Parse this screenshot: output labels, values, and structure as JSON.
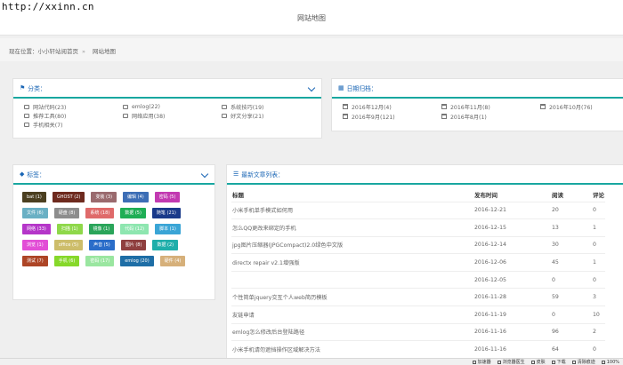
{
  "watermark": "http://xxinn.cn",
  "page_title": "网站地图",
  "breadcrumb": {
    "prefix": "现在位置：",
    "home": "小小轩站阅首页",
    "sep": "»",
    "current": "网站地图"
  },
  "categories": {
    "title": "分类：",
    "items": [
      "网站代码(23)",
      "emlog(22)",
      "系统技巧(19)",
      "推荐工具(80)",
      "网络应用(38)",
      "好文分享(21)",
      "手机相关(7)"
    ]
  },
  "archives": {
    "title": "日期归档：",
    "items": [
      "2016年12月(4)",
      "2016年11月(8)",
      "2016年10月(76)",
      "2016年9月(121)",
      "2016年8月(1)"
    ]
  },
  "tags": {
    "title": "标签：",
    "items": [
      {
        "label": "bat (1)",
        "color": "#4b3f20"
      },
      {
        "label": "GHOST (2)",
        "color": "#6e2a1e"
      },
      {
        "label": "变装 (3)",
        "color": "#9a6a6e"
      },
      {
        "label": "编辑 (4)",
        "color": "#3d6eb5"
      },
      {
        "label": "密码 (5)",
        "color": "#c23ab1"
      },
      {
        "label": "文件 (6)",
        "color": "#6ab0c4"
      },
      {
        "label": "硬盘 (8)",
        "color": "#8d8d8d"
      },
      {
        "label": "系统 (18)",
        "color": "#df6a6a"
      },
      {
        "label": "数据 (5)",
        "color": "#1fae55"
      },
      {
        "label": "随笔 (21)",
        "color": "#1a3a8a"
      },
      {
        "label": "网络 (33)",
        "color": "#b536c9"
      },
      {
        "label": "扫描 (1)",
        "color": "#8fd84a"
      },
      {
        "label": "镜像 (1)",
        "color": "#2aa55a"
      },
      {
        "label": "代码 (12)",
        "color": "#8ee6b0"
      },
      {
        "label": "脚本 (1)",
        "color": "#3aa5d6"
      },
      {
        "label": "浏览 (1)",
        "color": "#e24ed6"
      },
      {
        "label": "office (5)",
        "color": "#cdbd6a"
      },
      {
        "label": "声音 (5)",
        "color": "#2a6dc9"
      },
      {
        "label": "图片 (8)",
        "color": "#8f3f3f"
      },
      {
        "label": "数据 (2)",
        "color": "#1faeaa"
      },
      {
        "label": "测试 (7)",
        "color": "#ad4526"
      },
      {
        "label": "手机 (6)",
        "color": "#86d82a"
      },
      {
        "label": "密码 (17)",
        "color": "#9ae6a0"
      },
      {
        "label": "emlog (20)",
        "color": "#1e6ea6"
      },
      {
        "label": "硬件 (4)",
        "color": "#d6b07a"
      }
    ]
  },
  "articles": {
    "title": "最新文章列表：",
    "headers": [
      "标题",
      "发布时间",
      "阅读",
      "评论"
    ],
    "rows": [
      [
        "小米手机单手模式如何用",
        "2016-12-21",
        "20",
        "0"
      ],
      [
        "怎么QQ更改来绑定的手机",
        "2016-12-15",
        "13",
        "1"
      ],
      [
        "jpg图片压缩器(JPGCompact)2.0绿色中文版",
        "2016-12-14",
        "30",
        "0"
      ],
      [
        "directx repair v2.1增强版",
        "2016-12-06",
        "45",
        "1"
      ],
      [
        "",
        "2016-12-05",
        "0",
        "0"
      ],
      [
        "个性简单jquery交互个人web简历模板",
        "2016-11-28",
        "59",
        "3"
      ],
      [
        "友链申请",
        "2016-11-19",
        "0",
        "10"
      ],
      [
        "emlog怎么修改后台登陆路径",
        "2016-11-16",
        "96",
        "2"
      ],
      [
        "小米手机请勿遮挡操作区域解决方法",
        "2016-11-16",
        "64",
        "0"
      ]
    ]
  },
  "statusbar": [
    "加速器",
    "浏览器医生",
    "皮肤",
    "下载",
    "清除痕迹",
    "100%"
  ]
}
